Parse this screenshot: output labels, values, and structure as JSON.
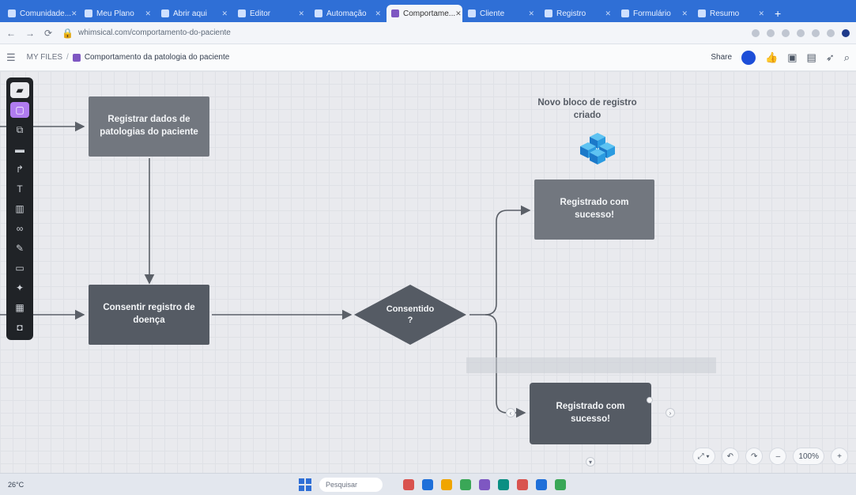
{
  "browser": {
    "tabs": [
      {
        "label": "Comunidade...",
        "active": false
      },
      {
        "label": "Meu Plano",
        "active": false
      },
      {
        "label": "Abrir aqui",
        "active": false
      },
      {
        "label": "Editor",
        "active": false
      },
      {
        "label": "Automação",
        "active": false
      },
      {
        "label": "Comportame...",
        "active": true
      },
      {
        "label": "Cliente",
        "active": false
      },
      {
        "label": "Registro",
        "active": false
      },
      {
        "label": "Formulário",
        "active": false
      },
      {
        "label": "Resumo",
        "active": false
      }
    ],
    "new_tab_label": "+",
    "url": "whimsical.com/comportamento-do-paciente"
  },
  "app": {
    "menu_icon": "menu-icon",
    "workspace": "MY FILES",
    "doc_title": "Comportamento da patologia do paciente",
    "share_label": "Share"
  },
  "canvas": {
    "nodes": {
      "register": "Registrar dados de patologias do paciente",
      "consent": "Consentir registro de doença",
      "decision": "Consentido ?",
      "success_top": "Registrado com sucesso!",
      "success_bottom": "Registrado com sucesso!"
    },
    "annotation": "Novo bloco de registro criado"
  },
  "toolbar": {
    "tools": [
      "cursor-icon",
      "sticky-note-icon",
      "flowchart-icon",
      "card-icon",
      "connector-icon",
      "text-icon",
      "grid-icon",
      "link-icon",
      "pen-icon",
      "frame-icon",
      "sparkle-icon",
      "table-icon",
      "embed-icon"
    ]
  },
  "zoom": {
    "level": "100%",
    "undo": "↶",
    "redo": "↷",
    "minus": "–",
    "plus": "+"
  },
  "taskbar": {
    "weather": "26°C",
    "search_placeholder": "Pesquisar",
    "apps": [
      "#d9534f",
      "#1e6fd9",
      "#f0a500",
      "#3aa757",
      "#7e57c2",
      "#0b8f83",
      "#d9534f",
      "#1e6fd9",
      "#3aa757"
    ],
    "clock": ""
  },
  "colors": {
    "node_light": "#72777f",
    "node_dark": "#555b64",
    "connector": "#5b6068",
    "accent": "#b07cf0"
  }
}
